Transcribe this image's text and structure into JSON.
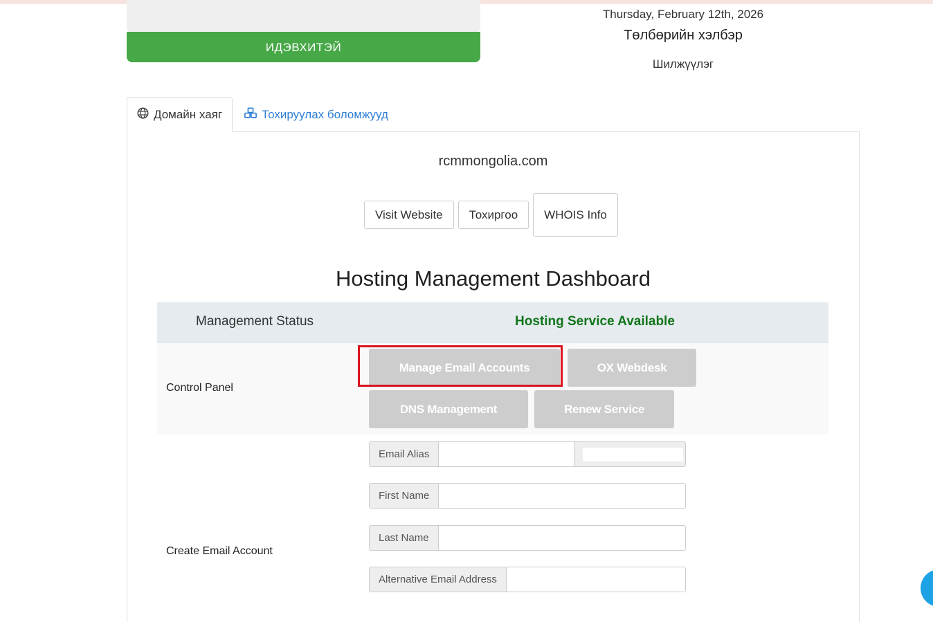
{
  "status_card": {
    "label": "ИДЭВХИТЭЙ"
  },
  "info": {
    "date": "Thursday, February 12th, 2026",
    "payment_method": "Төлбөрийн хэлбэр",
    "transfer": "Шилжүүлэг"
  },
  "tabs": [
    {
      "label": "Домайн хаяг",
      "icon": "globe-icon",
      "active": true
    },
    {
      "label": "Тохируулах боломжууд",
      "icon": "cubes-icon",
      "active": false
    }
  ],
  "domain": "rcmmongolia.com",
  "buttons": {
    "visit_website": "Visit Website",
    "settings": "Тохиргоо",
    "whois": "WHOIS Info"
  },
  "dashboard": {
    "title": "Hosting Management Dashboard",
    "status_label": "Management Status",
    "status_value": "Hosting Service Available",
    "control_panel_label": "Control Panel",
    "control_buttons": {
      "manage_email": "Manage Email Accounts",
      "ox_webdesk": "OX Webdesk",
      "dns": "DNS Management",
      "renew": "Renew Service"
    },
    "create_email_label": "Create Email Account",
    "form": {
      "email_alias": "Email Alias",
      "first_name": "First Name",
      "last_name": "Last Name",
      "alt_email": "Alternative Email Address"
    }
  },
  "colors": {
    "active_green": "#46a846",
    "status_green": "#12751a",
    "link_blue": "#2f7fd6",
    "highlight_red": "#d9141f",
    "disabled_gray": "#cdcdcd"
  }
}
